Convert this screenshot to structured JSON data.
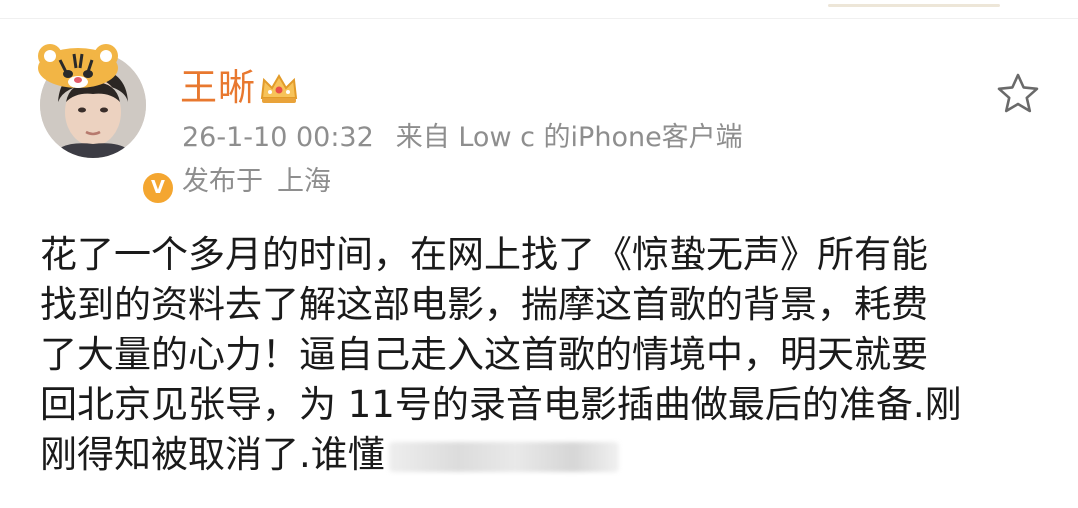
{
  "post": {
    "author": {
      "name": "王晰",
      "verified": true
    },
    "meta": {
      "timestamp": "26-1-10 00:32",
      "source": "来自 Low c 的iPhone客户端"
    },
    "location": {
      "prefix": "发布于",
      "city": "上海"
    },
    "body_lines": [
      "花了一个多月的时间，在网上找了《惊蛰无声》所有能",
      "找到的资料去了解这部电影，揣摩这首歌的背景，耗费",
      "了大量的心力！逼自己走入这首歌的情境中，明天就要",
      "回北京见张导，为 11号的录音电影插曲做最后的准备.刚",
      "刚得知被取消了.谁懂"
    ]
  },
  "icons": {
    "crown": "crown-icon",
    "favorite": "star-outline-icon",
    "verified": "verified-v-icon"
  },
  "colors": {
    "name": "#e8782f",
    "meta": "#8e8e8e",
    "body": "#1a1a1a",
    "verified": "#f4a630"
  }
}
